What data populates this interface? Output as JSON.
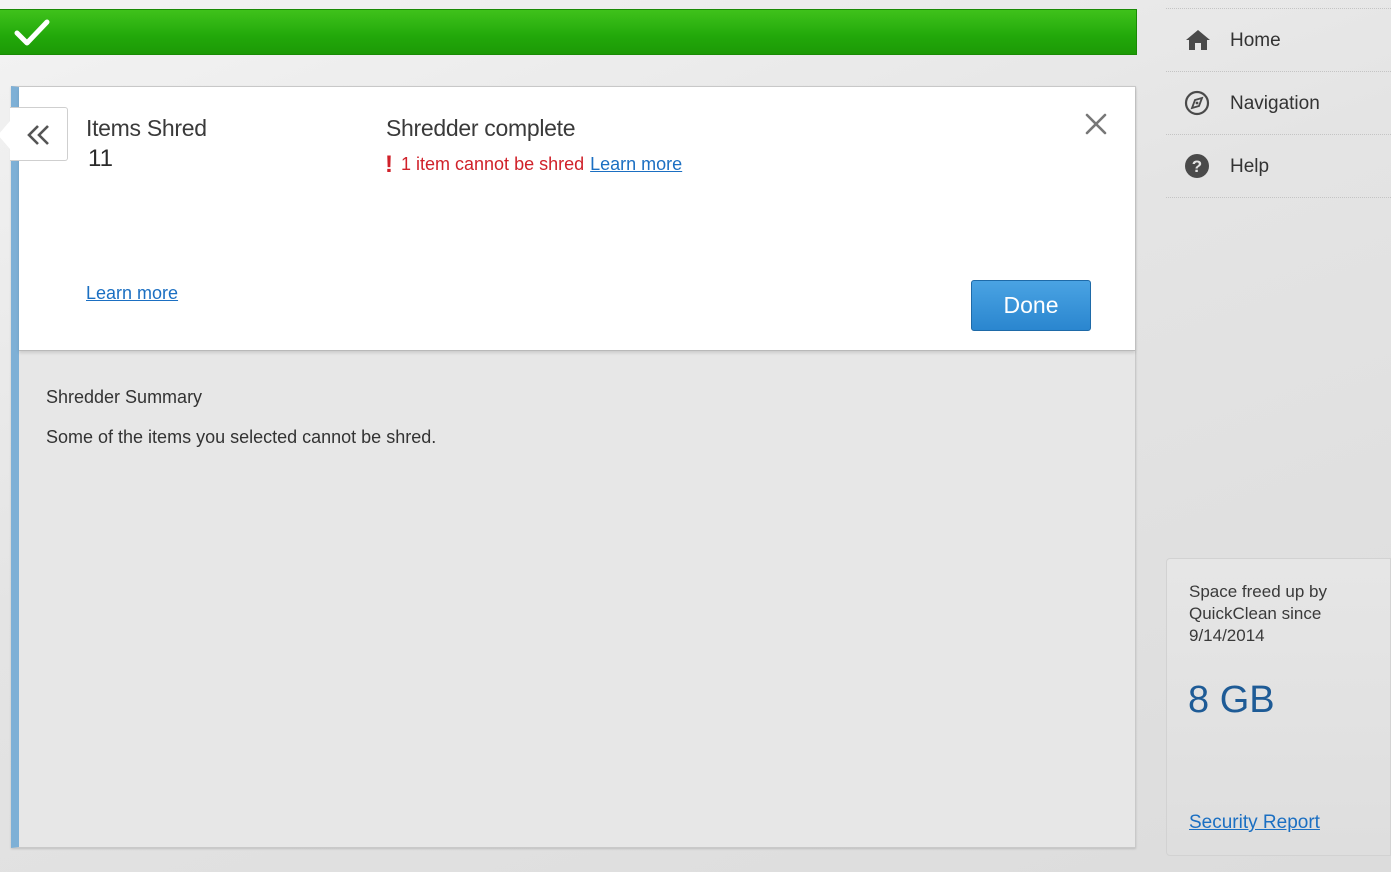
{
  "status": {
    "icon": "checkmark-icon",
    "color": "#22a80a"
  },
  "panel": {
    "back_icon": "double-chevron-left-icon",
    "items_label": "Items Shred",
    "items_count": "11",
    "complete_title": "Shredder complete",
    "warning": {
      "icon": "exclamation-icon",
      "bang": "!",
      "text": "1 item cannot be shred",
      "link": "Learn more",
      "color": "#d0212a"
    },
    "learn_more": "Learn more",
    "done_label": "Done",
    "close_icon": "close-icon"
  },
  "summary": {
    "title": "Shredder Summary",
    "text": "Some of the items you selected cannot be shred."
  },
  "sidebar": {
    "items": [
      {
        "label": "Home",
        "icon": "home-icon"
      },
      {
        "label": "Navigation",
        "icon": "compass-icon"
      },
      {
        "label": "Help",
        "icon": "help-icon"
      }
    ]
  },
  "space": {
    "text": "Space freed up by QuickClean since 9/14/2014",
    "value": "8 GB",
    "link": "Security Report"
  },
  "colors": {
    "accent": "#2a86cf",
    "link": "#1b6fc2",
    "value": "#1e5b96"
  }
}
